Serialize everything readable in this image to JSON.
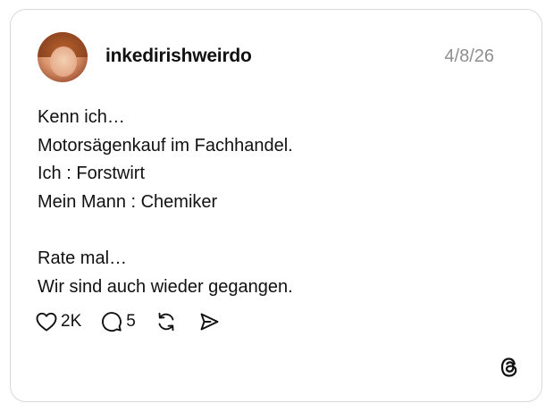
{
  "post": {
    "username": "inkedirishweirdo",
    "date": "4/8/26",
    "lines": [
      "Kenn ich…",
      "Motorsägenkauf im Fachhandel.",
      "Ich : Forstwirt",
      "Mein Mann : Chemiker",
      "",
      "Rate mal…",
      "Wir sind auch wieder gegangen."
    ]
  },
  "actions": {
    "likes": "2K",
    "comments": "5",
    "like_icon": "heart-icon",
    "comment_icon": "speech-bubble-icon",
    "repost_icon": "repost-arrows-icon",
    "share_icon": "send-icon"
  },
  "branding": {
    "logo_icon": "threads-logo-icon"
  }
}
